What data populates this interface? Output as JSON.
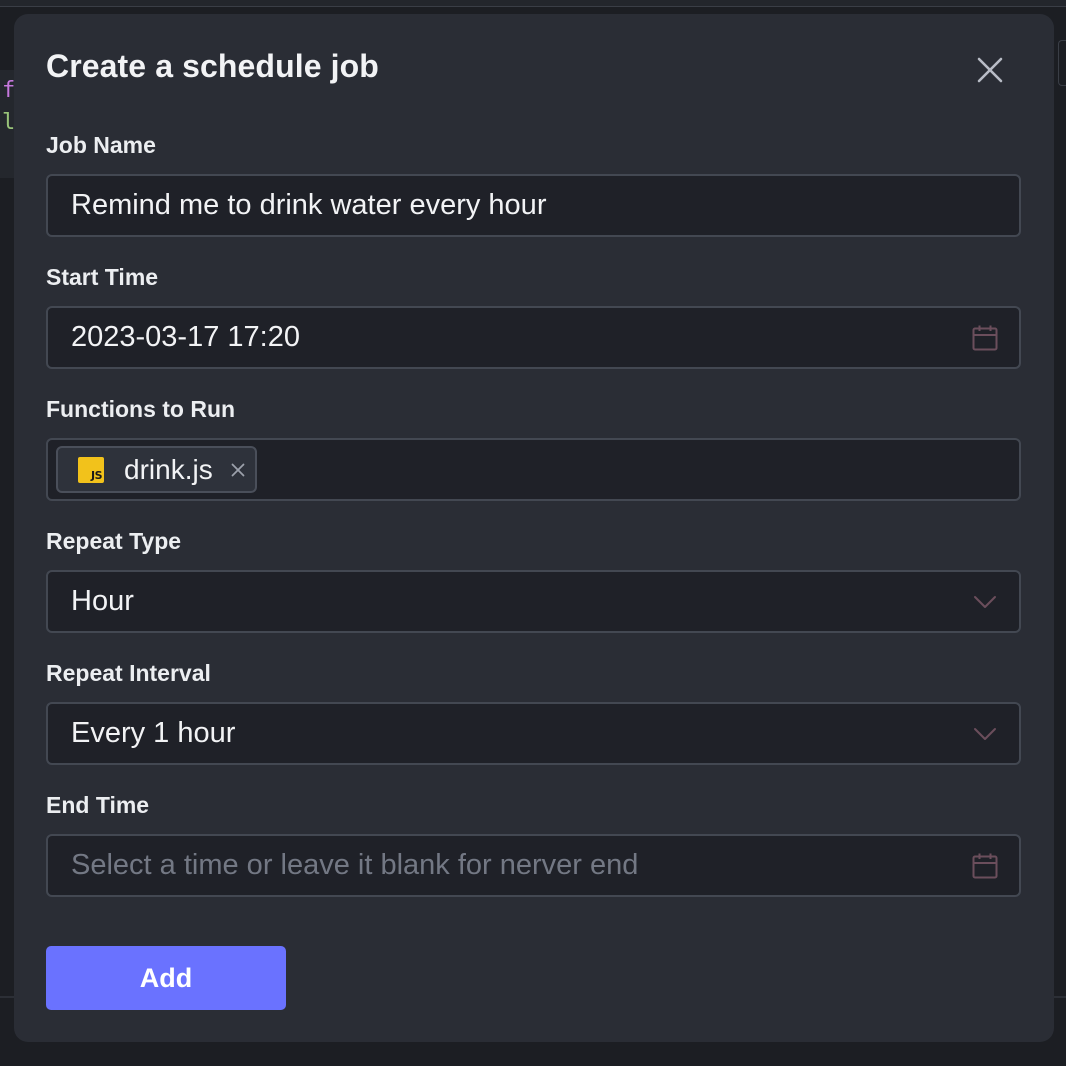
{
  "dialog": {
    "title": "Create a schedule job",
    "close_icon": "close-icon",
    "fields": {
      "job_name": {
        "label": "Job Name",
        "value": "Remind me to drink water every hour"
      },
      "start_time": {
        "label": "Start Time",
        "value": "2023-03-17 17:20",
        "icon": "calendar-icon"
      },
      "functions": {
        "label": "Functions to Run",
        "tags": [
          {
            "label": "drink.js",
            "icon": "js-file-icon",
            "badge_text": "JS"
          }
        ]
      },
      "repeat_type": {
        "label": "Repeat Type",
        "value": "Hour",
        "icon": "chevron-down-icon"
      },
      "repeat_interval": {
        "label": "Repeat Interval",
        "value": "Every 1 hour",
        "icon": "chevron-down-icon"
      },
      "end_time": {
        "label": "End Time",
        "value": "",
        "placeholder": "Select a time or leave it blank for nerver end",
        "icon": "calendar-icon"
      }
    },
    "add_button": "Add"
  },
  "background": {
    "code_lines": [
      "f",
      "l"
    ]
  },
  "colors": {
    "dialog_bg": "#2a2d35",
    "field_bg": "#1f2128",
    "field_border": "#434852",
    "accent": "#6a72ff",
    "js_badge": "#f2c21b",
    "icon_muted": "#6b4e5c"
  }
}
